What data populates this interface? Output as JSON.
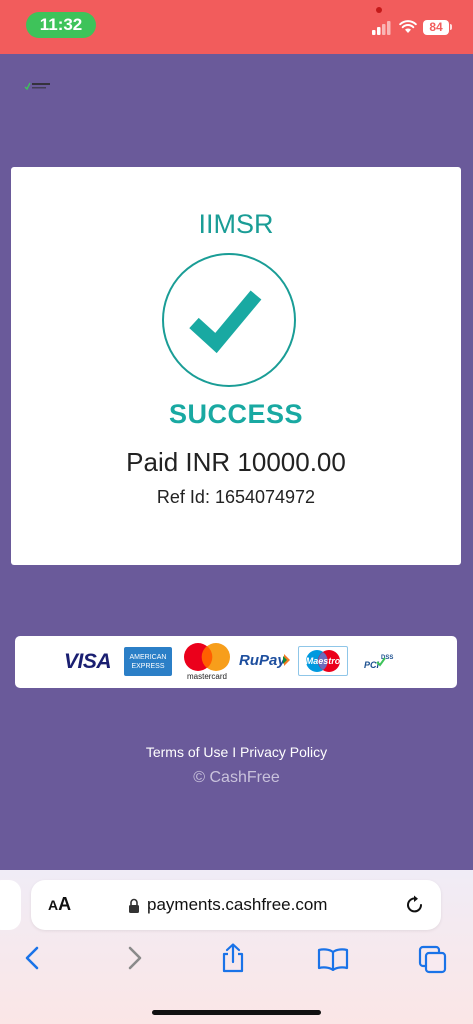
{
  "status_bar": {
    "time": "11:32",
    "battery": "84"
  },
  "brand": {
    "logo": "Cashfree Payments"
  },
  "receipt": {
    "merchant": "IIMSR",
    "status": "SUCCESS",
    "paid_label": "Paid INR 10000.00",
    "ref_label": "Ref Id:",
    "ref_value": "1654074972",
    "check_icon": "check-icon",
    "accent_color": "#1a9d96"
  },
  "payment_logos": {
    "visa": "VISA",
    "amex_top": "AMERICAN",
    "amex_bottom": "EXPRESS",
    "mastercard": "mastercard",
    "rupay": "RuPay",
    "maestro": "Maestro",
    "pci": "PCI",
    "dss": "DSS"
  },
  "footer": {
    "terms": "Terms of Use",
    "separator": "I",
    "privacy": "Privacy Policy",
    "copyright": "© CashFree"
  },
  "browser": {
    "text_size_big": "A",
    "text_size_small": "A",
    "url": "payments.cashfree.com"
  }
}
